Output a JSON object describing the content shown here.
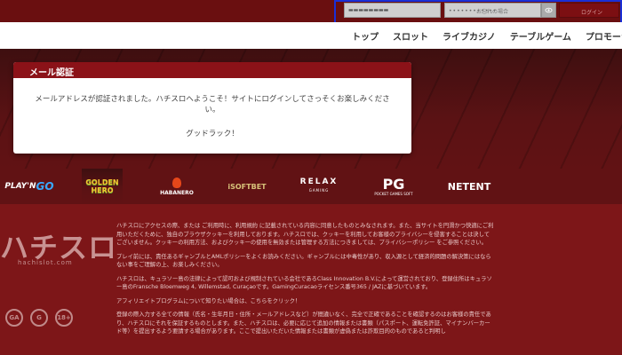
{
  "login": {
    "username_value": "▬▬▬▬▬▬▬▬",
    "password_value": "••••••••••••",
    "remember_label": "お忘れの場合",
    "login_button_label": "ログイン"
  },
  "nav": {
    "items": [
      "トップ",
      "スロット",
      "ライブカジノ",
      "テーブルゲーム",
      "プロモーシ"
    ]
  },
  "modal": {
    "title": "メール認証",
    "message": "メールアドレスが認証されました。ハチスロへようこそ！サイトにログインしてさっそくお楽しみください。",
    "closing": "グッドラック！"
  },
  "providers": {
    "play": "PLAY'N",
    "play_go": "GO",
    "golden": "GOLDEN",
    "hero": "HERO",
    "habanero": "HABANERO",
    "isoftbet": "iSOFTBET",
    "relax": "RELAX",
    "relax_sub": "GAMING",
    "pg": "PG",
    "pg_sub": "POCKET GAMES SOFT",
    "netent": "NETENT"
  },
  "footer": {
    "brand": "ハチスロ",
    "brand_sub": "hachislot.com",
    "badge_1": "GA",
    "badge_2": "G",
    "badge_3": "18+",
    "p1": "ハチスロにアクセスの際、または ご利用時に、利用規約 に記載されている内容に同意したものとみなされます。また、当サイトを円滑かつ快適にご利用いただくために、独自のブラウザクッキーを利用しております。ハチスロでは、クッキーを利用してお客様のプライバシーを侵害することは決してございません。クッキーの利用方法、およびクッキーの使用を無効または管理する方法につきましては、プライバシーポリシー をご参照ください。",
    "p2": "プレイ前には、責任あるギャンブルとAMLポリシーをよくお読みください。ギャンブルには中毒性があり、収入源として経済的問題の解決策にはならない事をご理解の上、お楽しみください。",
    "p3": "ハチスロは、キュラソー島の法律によって認可および規制されている会社であるClass Innovation B.V.によって運営されており、登録住所はキュラソー島のFransche Bloemweg 4, Willemstad, Curaçaoです。GamingCuracaoライセンス番号365 / JAZに基づいています。",
    "p4": "アフィリエイトプログラムについて知りたい場合は、こちらをクリック！",
    "p5": "登録の際入力する全ての情報（氏名・生年月日・住所・メールアドレスなど）が間違いなく、完全で正確であることを確認するのはお客様の責任であり、ハチスロにそれを保証するものとします。また、ハチスロは、必要に応じて追加の情報または書類（パスポート、運転免許証、マイナンバーカード等）を提出するよう要請する場合があります。ここで提出いただいた情報または書類が虚偽または詐欺目的のものであると判明し"
  },
  "colors": {
    "brand_red": "#8b1218",
    "highlight_border": "#1a2fd6",
    "footer_bg": "#7d1618"
  }
}
